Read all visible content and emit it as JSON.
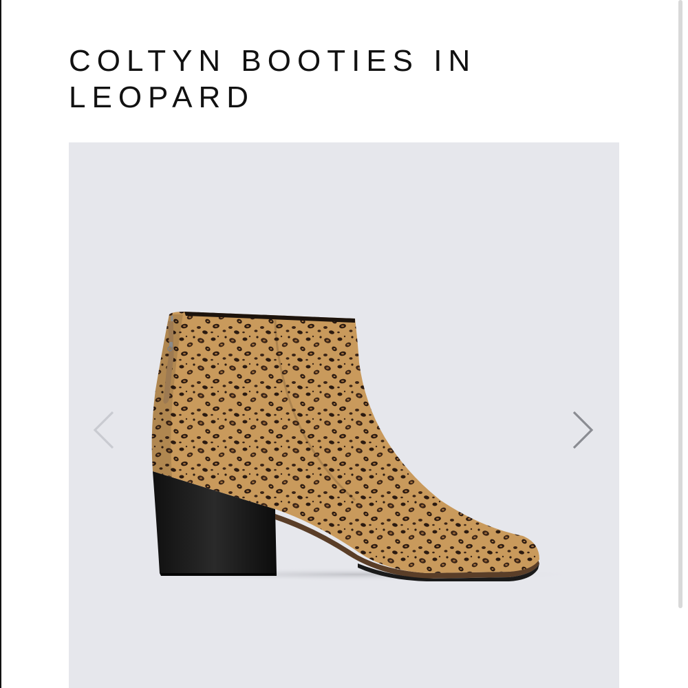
{
  "product": {
    "title": "COLTYN BOOTIES IN LEOPARD"
  },
  "gallery": {
    "image_alt": "Coltyn booties in leopard print suede with black stacked heel",
    "prev_icon": "chevron-left-icon",
    "next_icon": "chevron-right-icon"
  },
  "colors": {
    "gallery_background": "#e6e7ec",
    "arrow_prev": "#c9cbd1",
    "arrow_next": "#8a8c92",
    "title": "#111111"
  }
}
